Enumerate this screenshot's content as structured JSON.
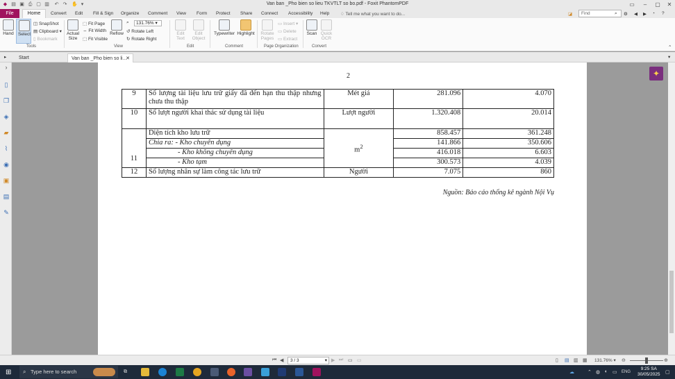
{
  "titlebar": {
    "title": "Van ban _Pho bien so lieu TKVTLT so bo.pdf - Foxit PhantomPDF"
  },
  "menu": {
    "file": "File",
    "tabs": [
      "Home",
      "Convert",
      "Edit",
      "Fill & Sign",
      "Organize",
      "Comment",
      "View",
      "Form",
      "Protect",
      "Share",
      "Connect",
      "Accessibility",
      "Help"
    ],
    "tell_me": "Tell me what you want to do...",
    "find_placeholder": "Find"
  },
  "ribbon": {
    "hand": "Hand",
    "select": "Select",
    "snapshot": "SnapShot",
    "clipboard": "Clipboard",
    "bookmark": "Bookmark",
    "actual_size": "Actual Size",
    "fit_page": "Fit Page",
    "fit_width": "Fit Width",
    "fit_visible": "Fit Visible",
    "zoom_value": "131.76%",
    "reflow": "Reflow",
    "rotate_left": "Rotate Left",
    "rotate_right": "Rotate Right",
    "edit_text": "Edit Text",
    "edit_object": "Edit Object",
    "typewriter": "Typewriter",
    "highlight": "Highlight",
    "rotate_pages": "Rotate Pages",
    "insert": "Insert",
    "delete": "Delete",
    "extract": "Extract",
    "scan": "Scan",
    "quick_ocr": "Quick OCR",
    "groups": [
      "Tools",
      "View",
      "Edit",
      "Comment",
      "Page Organization",
      "Convert"
    ]
  },
  "tabs": {
    "start": "Start",
    "doc": "Van ban _Pho bien so li..."
  },
  "document": {
    "page_number": "2",
    "rows": [
      {
        "no": "9",
        "desc": "Số lượng tài liệu lưu trữ giấy đã đến hạn thu thập nhưng chưa thu thập",
        "unit": "Mét giá",
        "v1": "281.096",
        "v2": "4.070"
      },
      {
        "no": "10",
        "desc": "Số lượt người khai thác sử dụng tài liệu",
        "unit": "Lượt người",
        "v1": "1.320.408",
        "v2": "20.014"
      },
      {
        "no": "11",
        "desc": "Diện tích kho lưu trữ",
        "unit": "m",
        "unit_sup": "2",
        "v1": "858.457",
        "v2": "361.248"
      },
      {
        "desc": "Chia ra: - Kho chuyên dụng",
        "v1": "141.866",
        "v2": "350.606"
      },
      {
        "desc": "- Kho không chuyên dụng",
        "v1": "416.018",
        "v2": "6.603"
      },
      {
        "desc": "- Kho tạm",
        "v1": "300.573",
        "v2": "4.039"
      },
      {
        "no": "12",
        "desc": "Số lượng nhân sự làm công tác lưu trữ",
        "unit": "Người",
        "v1": "7.075",
        "v2": "860"
      }
    ],
    "source": "Nguồn: Báo cáo thống kê ngành Nội Vụ"
  },
  "status": {
    "page_box": "3 / 3",
    "zoom": "131.76%"
  },
  "taskbar": {
    "search": "Type here to search",
    "lang": "ENG",
    "time": "9:25 SA",
    "date": "30/05/2025"
  }
}
